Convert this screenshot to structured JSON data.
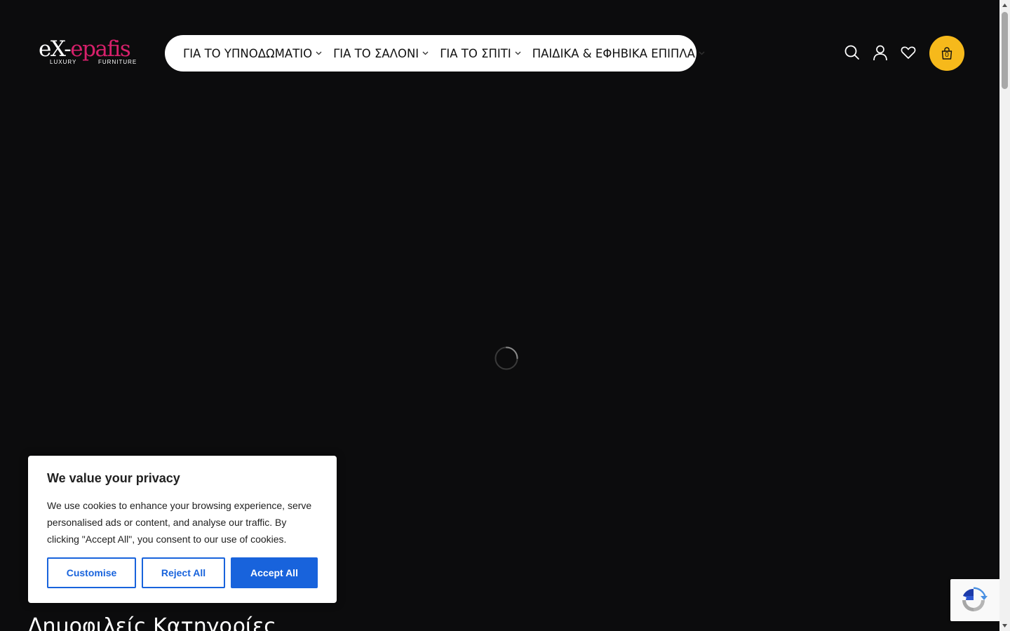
{
  "logo": {
    "part1": "eX-",
    "part2": "epafis",
    "sub_left": "LUXURY",
    "sub_right": "FURNITURE"
  },
  "nav": {
    "items": [
      {
        "label": "ΓΙΑ ΤΟ ΥΠΝΟΔΩΜΑΤΙΟ",
        "icon": "chevron-down-icon"
      },
      {
        "label": "ΓΙΑ ΤΟ ΣΑΛΟΝΙ",
        "icon": "chevron-down-icon"
      },
      {
        "label": "ΓΙΑ ΤΟ ΣΠΙΤΙ",
        "icon": "chevron-down-icon"
      },
      {
        "label": "ΠΑΙΔΙΚΑ & ΕΦΗΒΙΚΑ ΕΠΙΠΛΑ",
        "icon": "chevron-down-icon"
      }
    ]
  },
  "header": {
    "icons": [
      "search-icon",
      "user-icon",
      "heart-icon",
      "shopping-bag-icon"
    ],
    "cart_count": "0"
  },
  "main": {
    "section_title": "Δημοφιλείς Κατηγορίες"
  },
  "cookie": {
    "title": "We value your privacy",
    "text": "We use cookies to enhance your browsing experience, serve personalised ads or content, and analyse our traffic. By clicking \"Accept All\", you consent to our use of cookies.",
    "customise_label": "Customise",
    "reject_label": "Reject All",
    "accept_label": "Accept All"
  },
  "colors": {
    "background": "#0c0c0d",
    "brand_pink": "#d7206b",
    "cart_yellow": "#f6b91b",
    "cookie_blue": "#1863dc"
  }
}
